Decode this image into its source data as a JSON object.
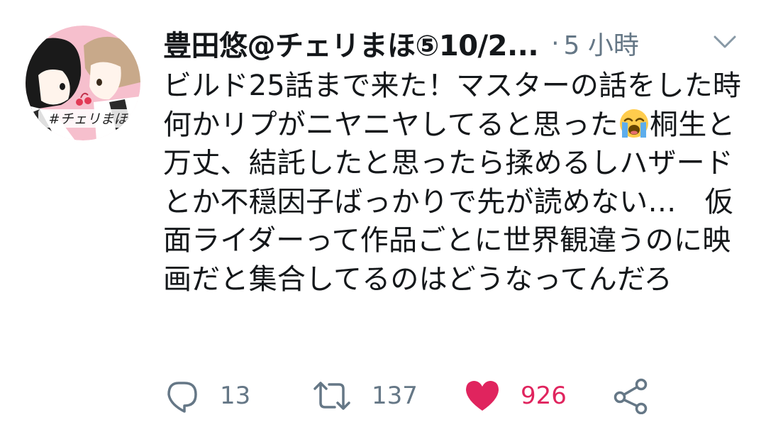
{
  "tweet": {
    "display_name": "豊田悠@チェリまほ⑤10/2...",
    "separator": "·",
    "timestamp": "5 小時",
    "text_before_emoji": "ビルド25話まで来た！マスターの話をした時何かリプがニヤニヤしてると思った",
    "emoji_name": "loudly-crying-face",
    "text_after_emoji": "桐生と万丈、結託したと思ったら揉めるしハザードとか不穏因子ばっかりで先が読めない…　仮面ライダーって作品ごとに世界観違うのに映画だと集合してるのはどうなってんだろ",
    "avatar_text": "#チェリまほ"
  },
  "actions": {
    "reply_count": "13",
    "retweet_count": "137",
    "like_count": "926"
  },
  "colors": {
    "text": "#14171a",
    "secondary": "#657786",
    "like": "#e0245e",
    "avatar_bg": "#f4b8c8"
  },
  "icons": {
    "menu": "chevron-down-icon",
    "reply": "reply-icon",
    "retweet": "retweet-icon",
    "like": "heart-icon",
    "share": "share-icon"
  }
}
